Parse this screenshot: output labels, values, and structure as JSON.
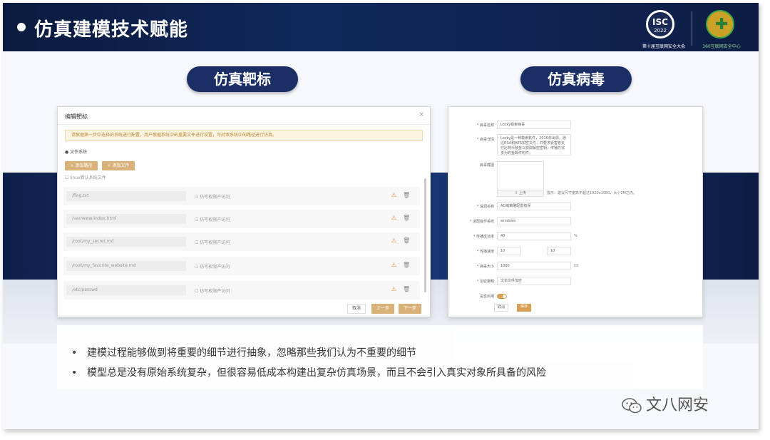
{
  "header": {
    "title": "仿真建模技术赋能",
    "logo_isc_main": "ISC",
    "logo_isc_year": "2022",
    "logo_isc_caption": "第十届互联网安全大会",
    "logo_360_caption": "360互联网安全中心"
  },
  "pills": {
    "left": "仿真靶标",
    "right": "仿真病毒"
  },
  "target_dialog": {
    "title": "编辑靶标",
    "close": "×",
    "warning": "请根据第一步中选择的系统进行配置，用户根据系统中的重要文件进行设置，可对本系统中的路径进行仿真。",
    "section_label": "● 文件系统",
    "btn_add_dir": "+ 添加路径",
    "btn_add_file": "+ 添加文件",
    "checkbox_label": "linux默认系统文件",
    "files": [
      {
        "name": "/flag.txt",
        "check": "仿写权限产访问"
      },
      {
        "name": "/var/www/index.html",
        "check": "仿写权限产访问"
      },
      {
        "name": "/root/my_secret.md",
        "check": "仿写权限产访问"
      },
      {
        "name": "/root/my_favorite_website.md",
        "check": "仿写权限产访问"
      },
      {
        "name": "/etc/passwd",
        "check": "仿写权限产访问"
      }
    ],
    "btn_cancel": "取消",
    "btn_prev": "上一步",
    "btn_next": "下一步"
  },
  "virus_form": {
    "fields": [
      {
        "label": "* 病毒名称",
        "value": "Locky勒索病毒"
      },
      {
        "label": "* 病毒详情",
        "value": "Locky是一种勒索软件，2016年出现。通过RSA和AES加密文件，并要求受害者支付比特币赎金以获取解密密钥，传播方式多为钓鱼邮件附件。"
      },
      {
        "label": "病毒截图",
        "value": ""
      },
      {
        "label": "* 漏洞名称",
        "value": "AD域策略配置错误"
      },
      {
        "label": "* 适配操作系统",
        "value": "windows"
      },
      {
        "label": "* 传播成功率",
        "value": "40"
      },
      {
        "label": "* 传播速度",
        "value": "10"
      },
      {
        "label": "* 病毒大小",
        "value": "1000"
      },
      {
        "label": "* 加密策略",
        "value": "文本文件加密"
      },
      {
        "label": "是否启用",
        "value": ""
      }
    ],
    "upload_btn": "⇪ 上传",
    "upload_hint": "提示：建议尺寸宽高不超过1920x1080，大小2M之内。",
    "speed_to": "10",
    "rate_unit": "%",
    "size_unit": "KB",
    "btn_cancel": "取消",
    "btn_save": "保存"
  },
  "notes": [
    "建模过程能够做到将重要的细节进行抽象，忽略那些我们认为不重要的细节",
    "模型总是没有原始系统复杂，但很容易低成本构建出复杂仿真场景，而且不会引入真实对象所具备的风险"
  ],
  "watermark": "文八网安"
}
